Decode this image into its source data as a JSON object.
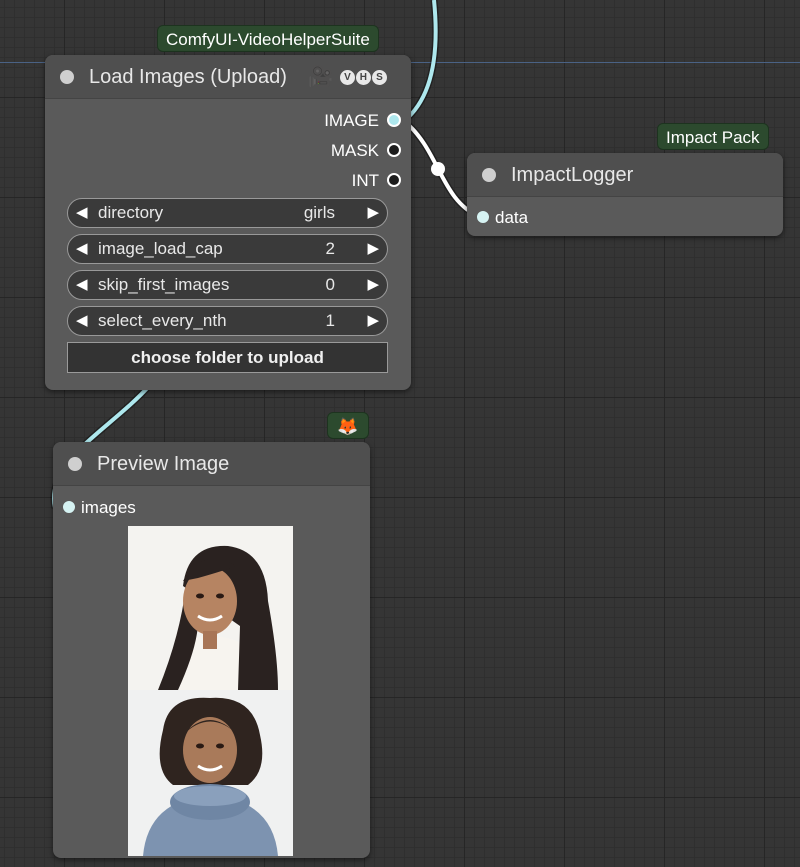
{
  "canvas": {
    "link_color": "#aee8ee",
    "link_color_white": "#ffffff"
  },
  "load_images_node": {
    "badge": "ComfyUI-VideoHelperSuite",
    "title": "Load Images (Upload)",
    "icons": [
      "video-camera-icon",
      "V",
      "H",
      "S"
    ],
    "outputs": [
      {
        "label": "IMAGE",
        "linked": true
      },
      {
        "label": "MASK",
        "linked": false
      },
      {
        "label": "INT",
        "linked": false
      }
    ],
    "widgets": [
      {
        "name": "directory",
        "value": "girls"
      },
      {
        "name": "image_load_cap",
        "value": "2"
      },
      {
        "name": "skip_first_images",
        "value": "0"
      },
      {
        "name": "select_every_nth",
        "value": "1"
      }
    ],
    "upload_button": "choose folder to upload"
  },
  "impact_logger_node": {
    "badge": "Impact Pack",
    "title": "ImpactLogger",
    "input": "data"
  },
  "preview_node": {
    "badge_icon": "fox-icon",
    "title": "Preview Image",
    "input": "images"
  }
}
